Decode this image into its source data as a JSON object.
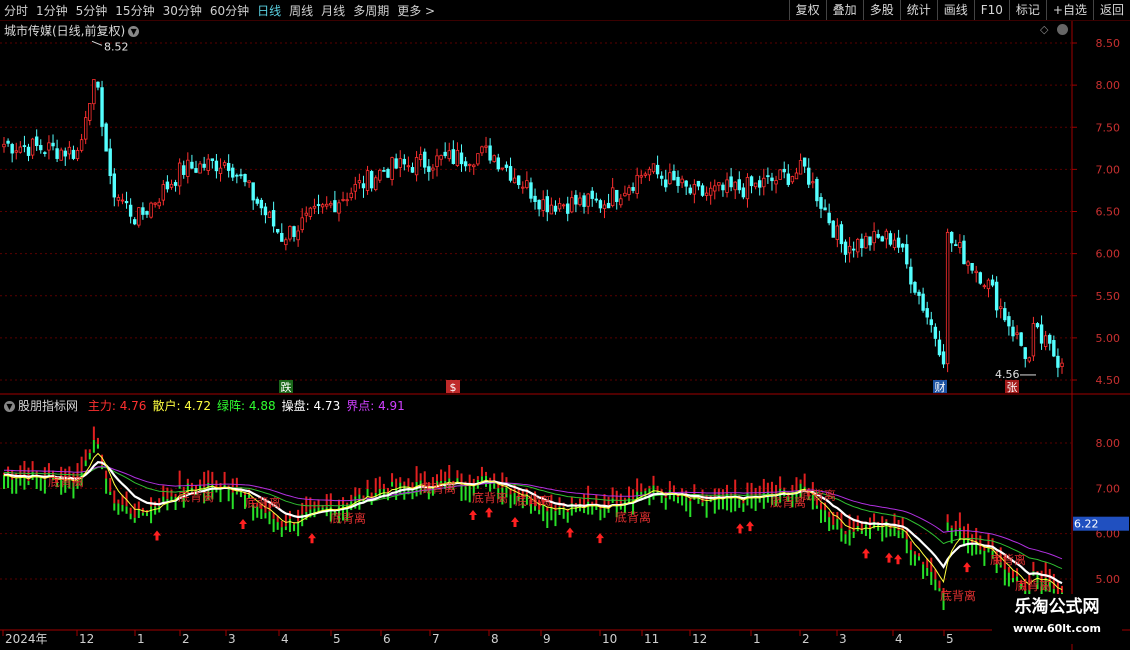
{
  "toolbar": {
    "periods": [
      "分时",
      "1分钟",
      "5分钟",
      "15分钟",
      "30分钟",
      "60分钟",
      "日线",
      "周线",
      "月线",
      "多周期",
      "更多 >"
    ],
    "active_period": "日线",
    "actions": [
      "复权",
      "叠加",
      "多股",
      "统计",
      "画线",
      "F10",
      "标记",
      "+自选",
      "返回"
    ]
  },
  "main": {
    "title": "城市传媒(日线,前复权)",
    "y_labels": [
      "8.50",
      "8.00",
      "7.50",
      "7.00",
      "6.50",
      "6.00",
      "5.50",
      "5.00",
      "4.50"
    ],
    "high_label": "8.52",
    "low_label": "4.56",
    "event_markers": [
      {
        "text": "跌",
        "color": "#1f7a1f"
      },
      {
        "text": "$",
        "color": "#e03030"
      },
      {
        "text": "财",
        "color": "#2060c0"
      },
      {
        "text": "张",
        "color": "#c02020"
      }
    ]
  },
  "indicator": {
    "name": "股朋指标网",
    "values": [
      {
        "label": "主力:",
        "value": "4.76",
        "color": "#ff3030"
      },
      {
        "label": "散户:",
        "value": "4.72",
        "color": "#ffff40"
      },
      {
        "label": "绿阵:",
        "value": "4.88",
        "color": "#30ff30"
      },
      {
        "label": "操盘:",
        "value": "4.73",
        "color": "#ffffff"
      },
      {
        "label": "界点:",
        "value": "4.91",
        "color": "#d040ff"
      }
    ],
    "y_labels": [
      "8.00",
      "7.00",
      "6.00",
      "5.00"
    ],
    "current_price": "6.22",
    "annotation_text": "底背离"
  },
  "date_axis": {
    "labels": [
      "2024年",
      "12",
      "1",
      "2",
      "3",
      "4",
      "5",
      "6",
      "7",
      "8",
      "9",
      "10",
      "11",
      "12",
      "1",
      "2",
      "3",
      "4",
      "5"
    ]
  },
  "watermark": {
    "line1": "乐淘公式网",
    "line2": "www.60lt.com"
  },
  "chart_data": {
    "type": "line",
    "title": "城市传媒(日线,前复权)",
    "x": [
      "12",
      "1",
      "2",
      "3",
      "4",
      "5",
      "6",
      "7",
      "8",
      "9",
      "10",
      "11",
      "12",
      "1",
      "2",
      "3",
      "4",
      "5"
    ],
    "series": [
      {
        "name": "close",
        "values": [
          7.2,
          6.4,
          7.0,
          7.1,
          6.2,
          6.6,
          7.0,
          7.1,
          7.2,
          6.6,
          6.6,
          7.0,
          6.7,
          6.8,
          7.0,
          6.1,
          6.2,
          4.7
        ]
      }
    ],
    "ylim": [
      4.5,
      8.52
    ],
    "annotations": [
      "8.52",
      "4.56"
    ]
  }
}
